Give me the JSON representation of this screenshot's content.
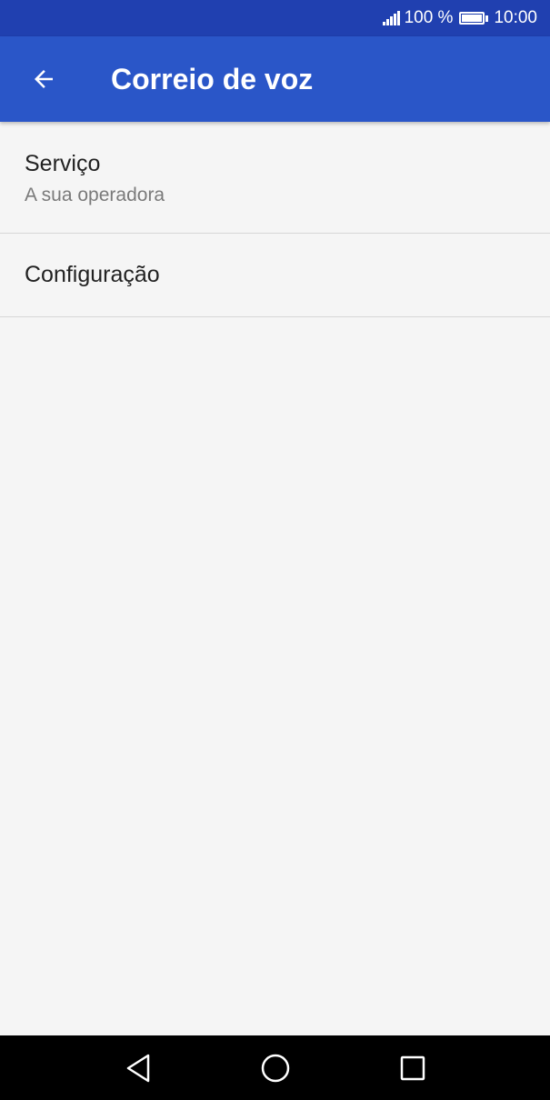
{
  "status_bar": {
    "battery_percent": "100 %",
    "time": "10:00",
    "signal_icon": "signal-icon",
    "battery_icon": "battery-icon"
  },
  "app_bar": {
    "title": "Correio de voz",
    "back_icon": "arrow-back-icon",
    "color": "#2a56c8"
  },
  "settings": [
    {
      "title": "Serviço",
      "subtitle": "A sua operadora"
    },
    {
      "title": "Configuração"
    }
  ],
  "nav_bar": {
    "back_icon": "triangle-back-icon",
    "home_icon": "circle-home-icon",
    "recents_icon": "square-recents-icon"
  },
  "colors": {
    "status_bar": "#2040b0",
    "app_bar": "#2a56c8",
    "background": "#f5f5f5",
    "nav_bar": "#000000"
  }
}
